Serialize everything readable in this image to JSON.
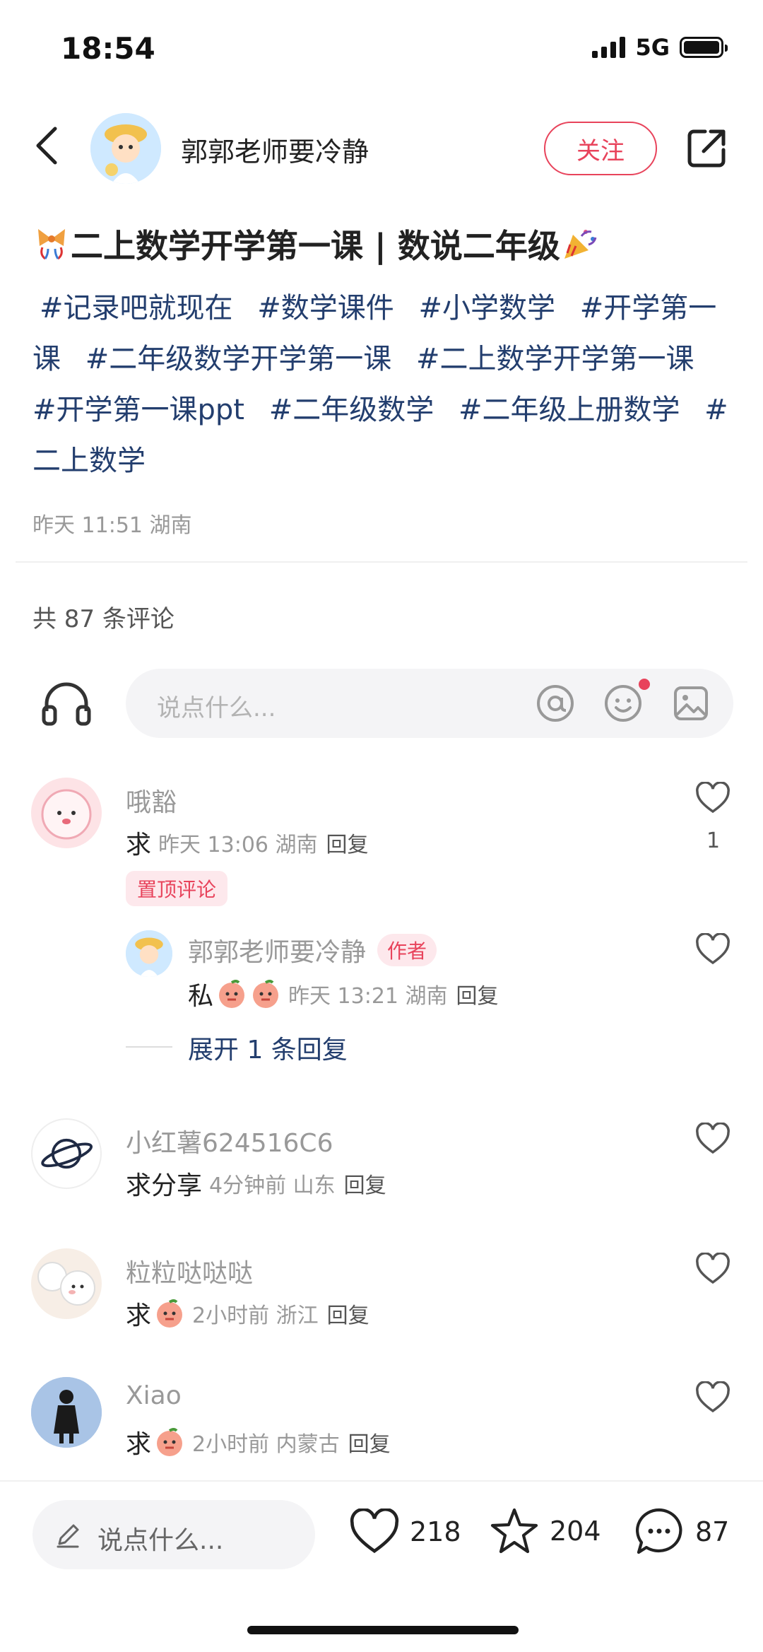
{
  "status": {
    "time": "18:54",
    "network": "5G"
  },
  "header": {
    "author": "郭郭老师要冷静",
    "follow_label": "关注"
  },
  "post": {
    "title": "二上数学开学第一课 | 数说二年级",
    "tags": [
      "#记录吧就现在",
      "#数学课件",
      "#小学数学",
      "#开学第一课",
      "#二年级数学开学第一课",
      "#二上数学开学第一课",
      "#开学第一课ppt",
      "#二年级数学",
      "#二年级上册数学",
      "#二上数学"
    ],
    "meta": "昨天 11:51 湖南"
  },
  "comments_section": {
    "count_label": "共 87 条评论",
    "input_placeholder": "说点什么...",
    "comments": [
      {
        "name": "哦豁",
        "text": "求",
        "time": "昨天 13:06 湖南",
        "reply": "回复",
        "likes": "1",
        "pinned_label": "置顶评论"
      },
      {
        "name": "小红薯624516C6",
        "text": "求分享",
        "time": "4分钟前 山东",
        "reply": "回复"
      },
      {
        "name": "粒粒哒哒哒",
        "text": "求",
        "time": "2小时前 浙江",
        "reply": "回复"
      },
      {
        "name": "Xiao",
        "text": "求",
        "time": "2小时前 内蒙古",
        "reply": "回复"
      }
    ],
    "sub_reply": {
      "name": "郭郭老师要冷静",
      "badge": "作者",
      "text": "私",
      "time": "昨天 13:21 湖南",
      "reply": "回复",
      "expand": "展开 1 条回复"
    }
  },
  "bottom": {
    "placeholder": "说点什么...",
    "likes": "218",
    "stars": "204",
    "comments": "87"
  },
  "colors": {
    "accent": "#e8435b",
    "tag": "#233e6e"
  }
}
